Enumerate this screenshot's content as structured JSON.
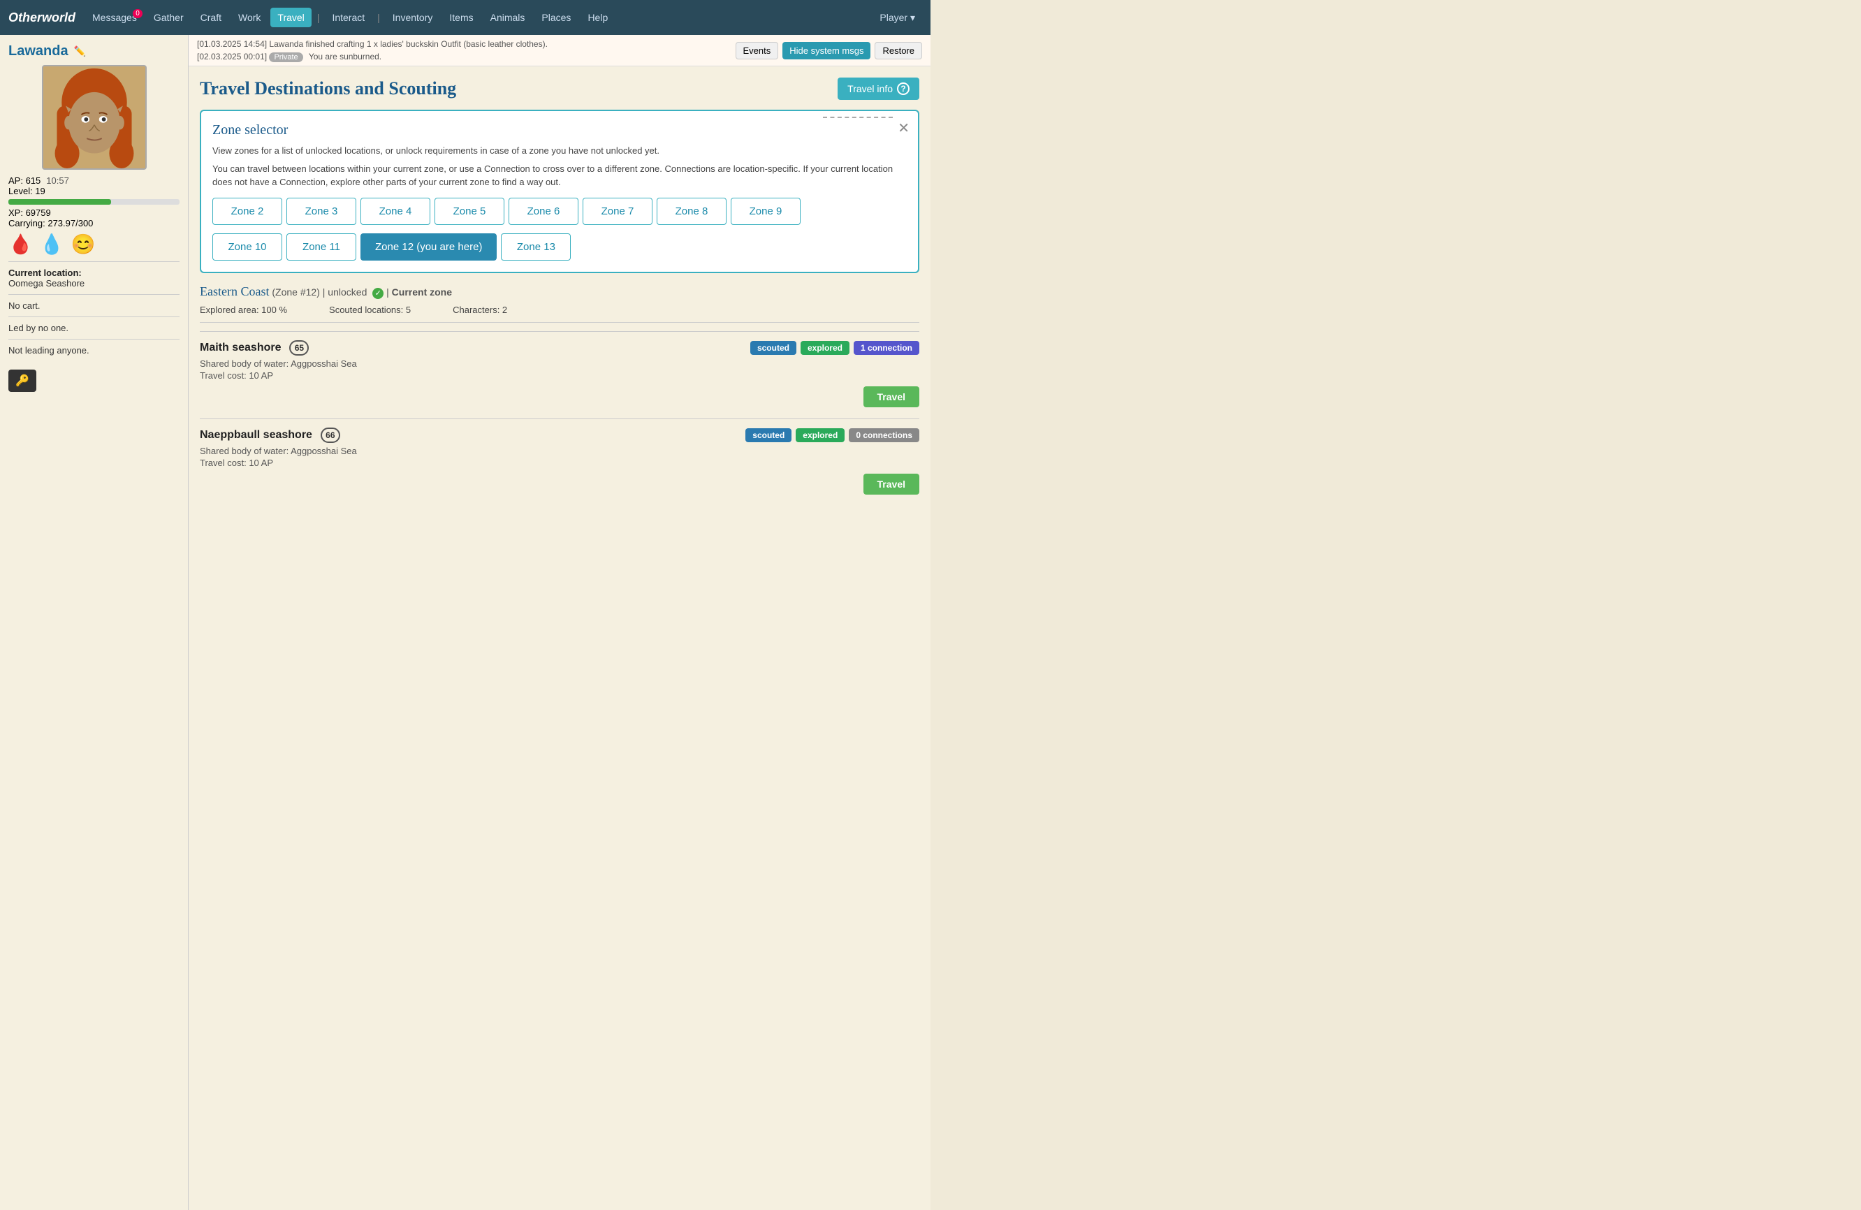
{
  "brand": "Otherworld",
  "nav": {
    "items": [
      {
        "label": "Messages",
        "badge": "0",
        "active": false,
        "name": "messages"
      },
      {
        "label": "Gather",
        "badge": null,
        "active": false,
        "name": "gather"
      },
      {
        "label": "Craft",
        "badge": null,
        "active": false,
        "name": "craft"
      },
      {
        "label": "Work",
        "badge": null,
        "active": false,
        "name": "work"
      },
      {
        "label": "Travel",
        "badge": null,
        "active": true,
        "name": "travel"
      },
      {
        "label": "Interact",
        "badge": null,
        "active": false,
        "name": "interact"
      },
      {
        "label": "Inventory",
        "badge": null,
        "active": false,
        "name": "inventory"
      },
      {
        "label": "Items",
        "badge": null,
        "active": false,
        "name": "items"
      },
      {
        "label": "Animals",
        "badge": null,
        "active": false,
        "name": "animals"
      },
      {
        "label": "Places",
        "badge": null,
        "active": false,
        "name": "places"
      },
      {
        "label": "Help",
        "badge": null,
        "active": false,
        "name": "help"
      },
      {
        "label": "Player ▾",
        "badge": null,
        "active": false,
        "name": "player"
      }
    ]
  },
  "topbar": {
    "system_msg": "[01.03.2025 14:54] Lawanda finished crafting 1 x ladies' buckskin Outfit (basic leather clothes).",
    "private_msg": "[02.03.2025 00:01]",
    "private_label": "Private",
    "private_text": "You are sunburned.",
    "btn_events": "Events",
    "btn_hide": "Hide system msgs",
    "btn_restore": "Restore"
  },
  "sidebar": {
    "player_name": "Lawanda",
    "ap": "AP: 615",
    "time": "10:57",
    "level": "Level: 19",
    "xp": "XP: 69759",
    "carrying": "Carrying: 273.97/300",
    "xp_pct": 60,
    "divider": true,
    "location_label": "Current location:",
    "location": "Oomega Seashore",
    "cart": "No cart.",
    "led_by": "Led by no one.",
    "leading": "Not leading anyone."
  },
  "page": {
    "title": "Travel Destinations and Scouting",
    "travel_info_btn": "Travel info",
    "zone_selector": {
      "title": "Zone selector",
      "desc1": "View zones for a list of unlocked locations, or unlock requirements in case of a zone you have not unlocked yet.",
      "desc2": "You can travel between locations within your current zone, or use a Connection to cross over to a different zone. Connections are location-specific. If your current location does not have a Connection, explore other parts of your current zone to find a way out.",
      "zones_row1": [
        "Zone 2",
        "Zone 3",
        "Zone 4",
        "Zone 5",
        "Zone 6",
        "Zone 7",
        "Zone 8",
        "Zone 9"
      ],
      "zones_row2": [
        "Zone 10",
        "Zone 11",
        "Zone 12 (you are here)",
        "Zone 13"
      ],
      "active_zone": "Zone 12 (you are here)"
    },
    "eastern_coast": {
      "name": "Eastern Coast",
      "zone_num": "Zone #12",
      "unlocked": true,
      "current": "Current zone",
      "explored": "Explored area: 100 %",
      "scouted_locations": "Scouted locations: 5",
      "characters": "Characters: 2"
    },
    "locations": [
      {
        "name": "Maith seashore",
        "num": "65",
        "badges": [
          "scouted",
          "explored",
          "1 connection"
        ],
        "shared_water": "Shared body of water: Aggposshai Sea",
        "travel_cost": "Travel cost: 10 AP",
        "has_travel": true
      },
      {
        "name": "Naeppbaull seashore",
        "num": "66",
        "badges": [
          "scouted",
          "explored",
          "0 connections"
        ],
        "shared_water": "Shared body of water: Aggposshai Sea",
        "travel_cost": "Travel cost: 10 AP",
        "has_travel": true
      }
    ]
  }
}
